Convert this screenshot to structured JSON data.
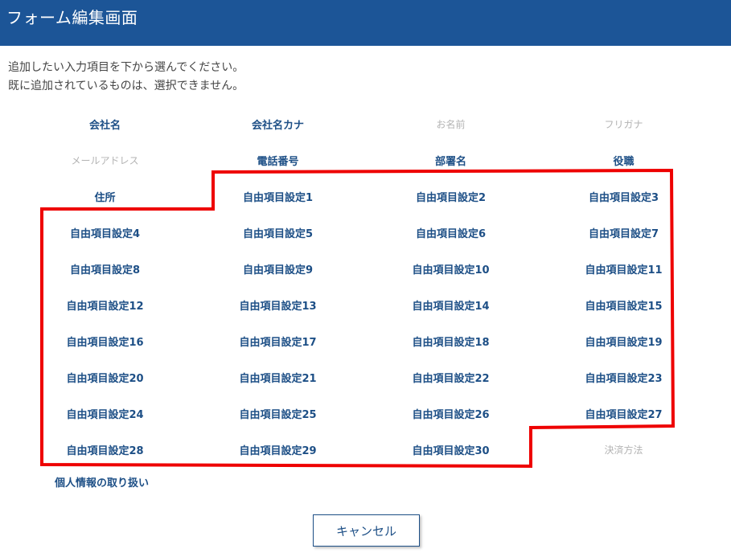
{
  "header": {
    "title": "フォーム編集画面"
  },
  "instructions": {
    "line1": "追加したい入力項目を下から選んでください。",
    "line2": "既に追加されているものは、選択できません。"
  },
  "fields": {
    "rows": [
      [
        {
          "label": "会社名",
          "enabled": true
        },
        {
          "label": "会社名カナ",
          "enabled": true
        },
        {
          "label": "お名前",
          "enabled": false
        },
        {
          "label": "フリガナ",
          "enabled": false
        }
      ],
      [
        {
          "label": "メールアドレス",
          "enabled": false
        },
        {
          "label": "電話番号",
          "enabled": true
        },
        {
          "label": "部署名",
          "enabled": true
        },
        {
          "label": "役職",
          "enabled": true
        }
      ],
      [
        {
          "label": "住所",
          "enabled": true
        },
        {
          "label": "自由項目設定1",
          "enabled": true
        },
        {
          "label": "自由項目設定2",
          "enabled": true
        },
        {
          "label": "自由項目設定3",
          "enabled": true
        }
      ],
      [
        {
          "label": "自由項目設定4",
          "enabled": true
        },
        {
          "label": "自由項目設定5",
          "enabled": true
        },
        {
          "label": "自由項目設定6",
          "enabled": true
        },
        {
          "label": "自由項目設定7",
          "enabled": true
        }
      ],
      [
        {
          "label": "自由項目設定8",
          "enabled": true
        },
        {
          "label": "自由項目設定9",
          "enabled": true
        },
        {
          "label": "自由項目設定10",
          "enabled": true
        },
        {
          "label": "自由項目設定11",
          "enabled": true
        }
      ],
      [
        {
          "label": "自由項目設定12",
          "enabled": true
        },
        {
          "label": "自由項目設定13",
          "enabled": true
        },
        {
          "label": "自由項目設定14",
          "enabled": true
        },
        {
          "label": "自由項目設定15",
          "enabled": true
        }
      ],
      [
        {
          "label": "自由項目設定16",
          "enabled": true
        },
        {
          "label": "自由項目設定17",
          "enabled": true
        },
        {
          "label": "自由項目設定18",
          "enabled": true
        },
        {
          "label": "自由項目設定19",
          "enabled": true
        }
      ],
      [
        {
          "label": "自由項目設定20",
          "enabled": true
        },
        {
          "label": "自由項目設定21",
          "enabled": true
        },
        {
          "label": "自由項目設定22",
          "enabled": true
        },
        {
          "label": "自由項目設定23",
          "enabled": true
        }
      ],
      [
        {
          "label": "自由項目設定24",
          "enabled": true
        },
        {
          "label": "自由項目設定25",
          "enabled": true
        },
        {
          "label": "自由項目設定26",
          "enabled": true
        },
        {
          "label": "自由項目設定27",
          "enabled": true
        }
      ],
      [
        {
          "label": "自由項目設定28",
          "enabled": true
        },
        {
          "label": "自由項目設定29",
          "enabled": true
        },
        {
          "label": "自由項目設定30",
          "enabled": true
        },
        {
          "label": "決済方法",
          "enabled": false
        }
      ]
    ],
    "privacy": "個人情報の取り扱い"
  },
  "footer": {
    "cancel_label": "キャンセル"
  },
  "colors": {
    "header_bg": "#1c5597",
    "link": "#1d4f86",
    "disabled": "#b3b3b3",
    "highlight": "#ee0000"
  }
}
